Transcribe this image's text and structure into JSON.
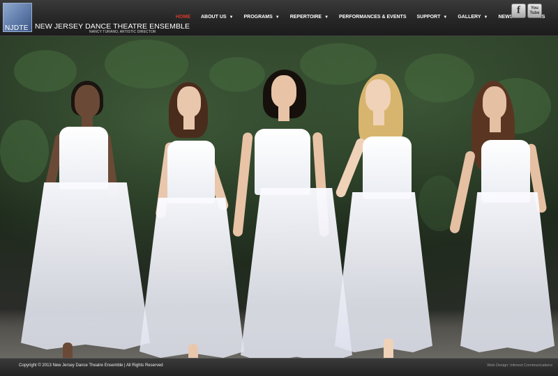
{
  "header": {
    "logo_text": "NJDTE",
    "site_title": "NEW JERSEY DANCE THEATRE ENSEMBLE",
    "subtitle": "NANCY TURANO, ARTISTIC DIRECTOR"
  },
  "nav": {
    "items": [
      {
        "label": "HOME",
        "dropdown": false,
        "active": true
      },
      {
        "label": "ABOUT US",
        "dropdown": true,
        "active": false
      },
      {
        "label": "PROGRAMS",
        "dropdown": true,
        "active": false
      },
      {
        "label": "REPERTOIRE",
        "dropdown": true,
        "active": false
      },
      {
        "label": "PERFORMANCES & EVENTS",
        "dropdown": false,
        "active": false
      },
      {
        "label": "SUPPORT",
        "dropdown": true,
        "active": false
      },
      {
        "label": "GALLERY",
        "dropdown": true,
        "active": false
      },
      {
        "label": "NEWS",
        "dropdown": true,
        "active": false
      },
      {
        "label": "LINKS",
        "dropdown": false,
        "active": false
      }
    ],
    "dropdown_glyph": "▼"
  },
  "social": {
    "facebook_glyph": "f",
    "youtube_glyph": "You Tube"
  },
  "footer": {
    "copyright": "Copyright © 2013 New Jersey Dance Theatre Ensemble | All Rights Reserved",
    "credit": "Web Design: Inforest Communications"
  },
  "colors": {
    "active_nav": "#d23c2a",
    "header_bg": "#2a2a2a",
    "logo_blue": "#5a77a6"
  }
}
